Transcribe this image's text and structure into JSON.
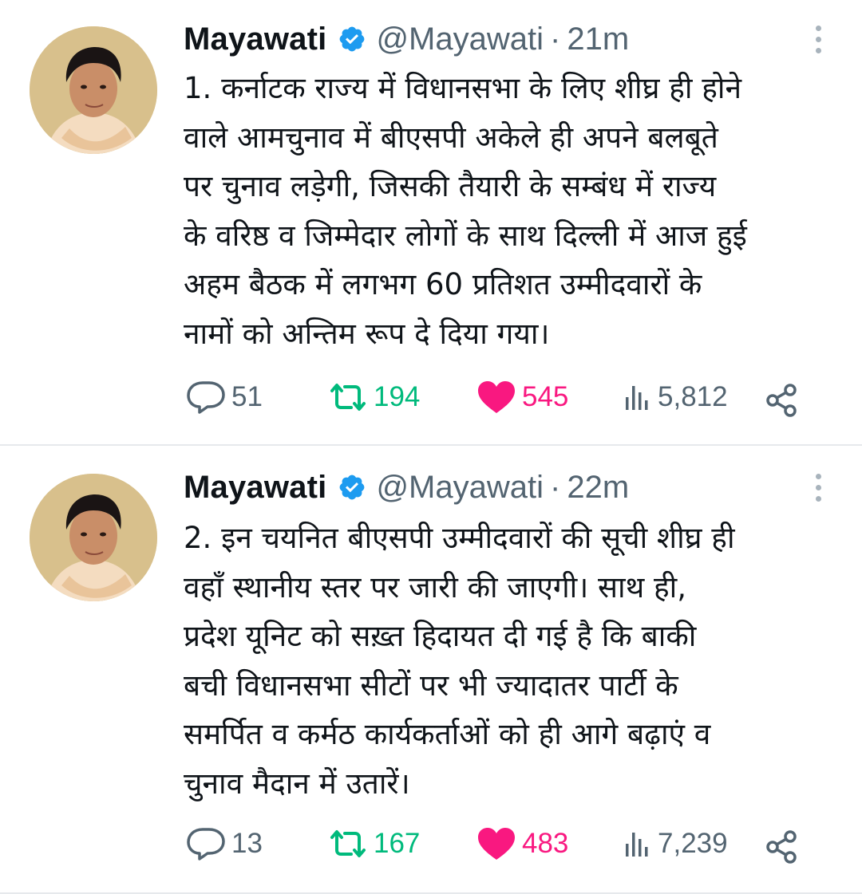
{
  "tweets": [
    {
      "author_name": "Mayawati",
      "handle": "@Mayawati",
      "separator": "·",
      "time": "21m",
      "text": "1. कर्नाटक राज्य में विधानसभा के लिए शीघ्र ही होने\nवाले आमचुनाव में बीएसपी अकेले ही अपने बलबूते\nपर चुनाव लड़ेगी, जिसकी तैयारी के सम्बंध में राज्य\nके वरिष्ठ व जिम्मेदार लोगों के साथ दिल्ली में आज हुई\nअहम बैठक में लगभग 60 प्रतिशत उम्मीदवारों के\nनामों को अन्तिम रूप दे दिया गया।",
      "replies": "51",
      "retweets": "194",
      "likes": "545",
      "views": "5,812"
    },
    {
      "author_name": "Mayawati",
      "handle": "@Mayawati",
      "separator": "·",
      "time": "22m",
      "text": "2. इन चयनित बीएसपी उम्मीदवारों की सूची शीघ्र ही\nवहाँ स्थानीय स्तर पर जारी की जाएगी। साथ ही,\nप्रदेश यूनिट को सख़्त हिदायत दी गई है कि बाकी\nबची विधानसभा सीटों पर भी ज्यादातर पार्टी के\nसमर्पित व कर्मठ कार्यकर्ताओं को ही आगे बढ़ाएं व\nचुनाव मैदान में उतारें।",
      "replies": "13",
      "retweets": "167",
      "likes": "483",
      "views": "7,239"
    }
  ],
  "icons": {
    "verified": "verified-badge-icon",
    "more": "more-vertical-icon",
    "reply": "reply-bubble-icon",
    "retweet": "retweet-icon",
    "like": "heart-filled-icon",
    "views": "views-bar-chart-icon",
    "share": "share-icon"
  },
  "colors": {
    "text": "#0f1419",
    "muted": "#536471",
    "verified": "#1d9bf0",
    "retweet": "#00ba7c",
    "like": "#f91880",
    "divider": "#e6e9ec"
  }
}
